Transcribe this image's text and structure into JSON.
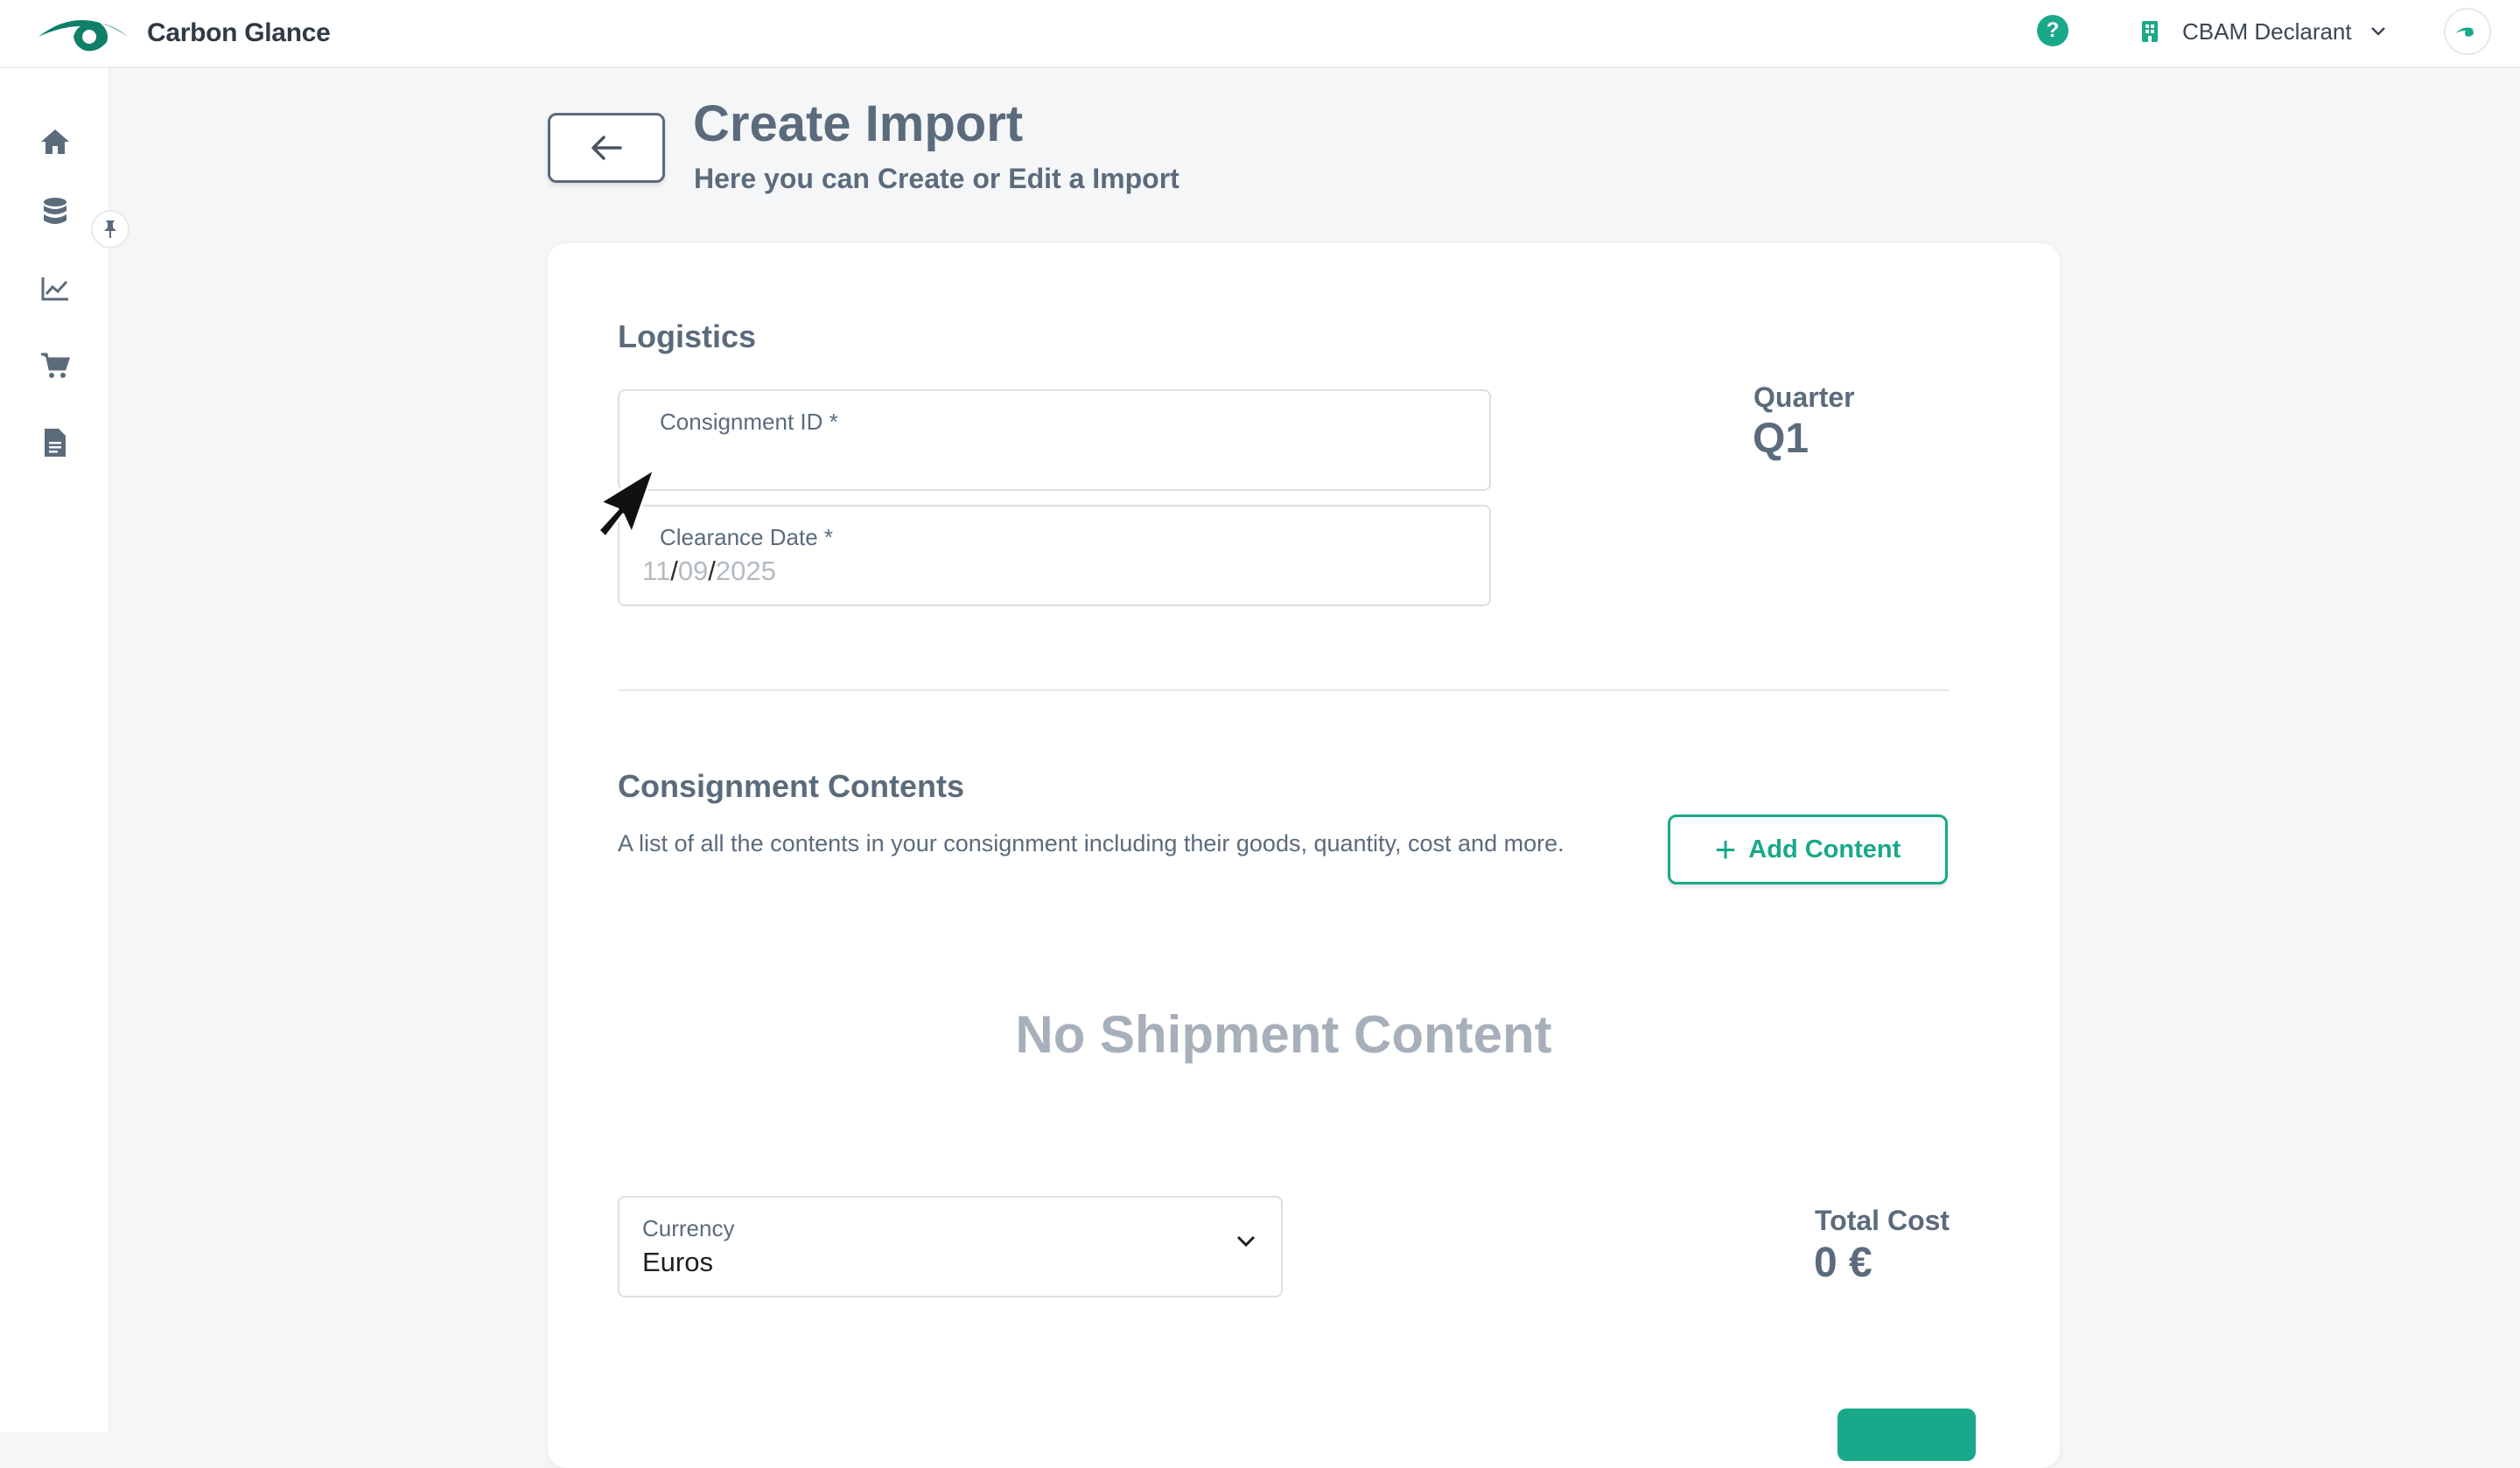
{
  "app": {
    "name": "Carbon Glance"
  },
  "header": {
    "help_icon": "?",
    "role": "CBAM Declarant"
  },
  "sidebar": {
    "items": [
      "home-icon",
      "database-icon",
      "chart-line-icon",
      "cart-icon",
      "document-icon"
    ],
    "pin": "pin-icon"
  },
  "page": {
    "title": "Create Import",
    "subtitle": "Here you can Create or Edit a Import"
  },
  "logistics": {
    "title": "Logistics",
    "consignment_id": {
      "label": "Consignment ID *",
      "value": ""
    },
    "clearance_date": {
      "label": "Clearance Date *",
      "day": "11",
      "month": "09",
      "year": "2025"
    },
    "quarter_label": "Quarter",
    "quarter_value": "Q1"
  },
  "contents": {
    "title": "Consignment Contents",
    "description": "A list of all the contents in your consignment including their goods, quantity, cost and more.",
    "add_label": "Add Content",
    "empty_text": "No Shipment Content"
  },
  "currency": {
    "label": "Currency",
    "value": "Euros"
  },
  "total": {
    "label": "Total Cost",
    "value": "0 €"
  },
  "colors": {
    "accent": "#1aa88a",
    "text": "#5b6b7c",
    "muted": "#a7b0ba"
  }
}
